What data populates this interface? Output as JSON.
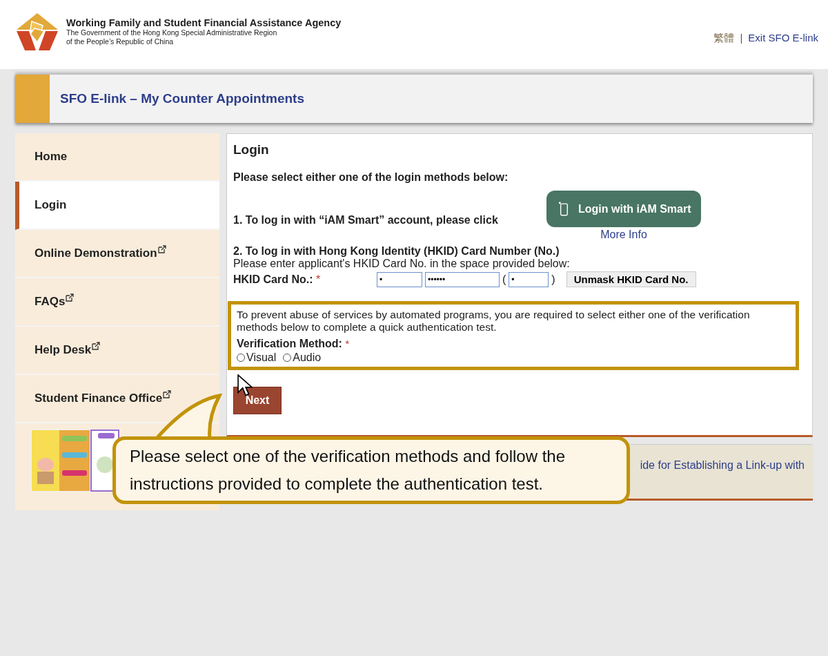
{
  "header": {
    "agency": "Working Family and Student Financial Assistance Agency",
    "government": "The Government of the Hong Kong Special Administrative Region",
    "government_2": "of the People’s Republic of China",
    "language_link": "繁體",
    "separator": "|",
    "exit_link": "Exit SFO E-link"
  },
  "title_bar": {
    "title": "SFO E-link – My Counter Appointments"
  },
  "sidebar": {
    "items": [
      {
        "label": "Home",
        "selected": false,
        "external": false
      },
      {
        "label": "Login",
        "selected": true,
        "external": false
      },
      {
        "label": "Online Demonstration",
        "selected": false,
        "external": true
      },
      {
        "label": "FAQs",
        "selected": false,
        "external": true
      },
      {
        "label": "Help Desk",
        "selected": false,
        "external": true
      },
      {
        "label": "Student Finance Office",
        "selected": false,
        "external": true
      }
    ]
  },
  "login": {
    "heading": "Login",
    "intro": "Please select either one of the login methods below:",
    "method_1": "1. To log in with “iAM Smart” account, please click",
    "iam_button": "Login with iAM Smart",
    "more_info": "More Info",
    "method_2": "2. To log in with Hong Kong Identity (HKID) Card Number (No.)",
    "method_2_hint": "Please enter applicant's HKID Card No. in the space provided below:",
    "hkid_label": "HKID Card No.:",
    "required_mark": "*",
    "hkid_parts": [
      "•",
      "••••••",
      "•"
    ],
    "paren_open": "(",
    "paren_close": ")",
    "unmask_button": "Unmask HKID Card No.",
    "verification_text": "To prevent abuse of services by automated programs, you are required to select either one of the verification methods below to complete a quick authentication test.",
    "verification_label": "Verification Method:",
    "verification_required": "*",
    "verification_options": [
      {
        "label": "Visual",
        "selected": false
      },
      {
        "label": "Audio",
        "selected": false
      }
    ],
    "next_button": "Next"
  },
  "footer_panel": {
    "text": "ide for Establishing a Link-up with"
  },
  "callout": {
    "text": "Please select one of the verification methods and follow the instructions provided to complete the authentication test."
  }
}
